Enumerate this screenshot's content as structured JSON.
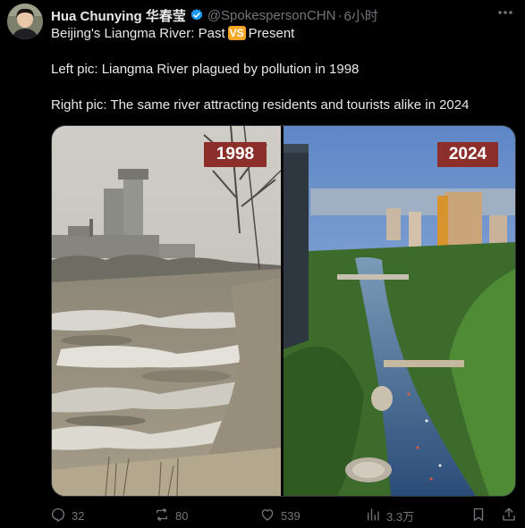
{
  "author": {
    "display_name": "Hua Chunying 华春莹",
    "handle": "@SpokespersonCHN",
    "separator": "·",
    "time": "6小时"
  },
  "tweet": {
    "line1_before": "Beijing's Liangma River: Past",
    "line1_badge": "VS",
    "line1_after": "Present",
    "line2": "Left pic: Liangma River plagued by pollution in 1998",
    "line3": "Right pic: The same river attracting residents and tourists alike in 2024"
  },
  "media": {
    "left_year": "1998",
    "right_year": "2024"
  },
  "actions": {
    "replies": "32",
    "retweets": "80",
    "likes": "539",
    "views": "3.3万"
  },
  "colors": {
    "background": "#000000",
    "text": "#e7e9ea",
    "muted": "#71767b",
    "verified": "#1d9bf0",
    "year_badge": "#8c2f2a"
  }
}
